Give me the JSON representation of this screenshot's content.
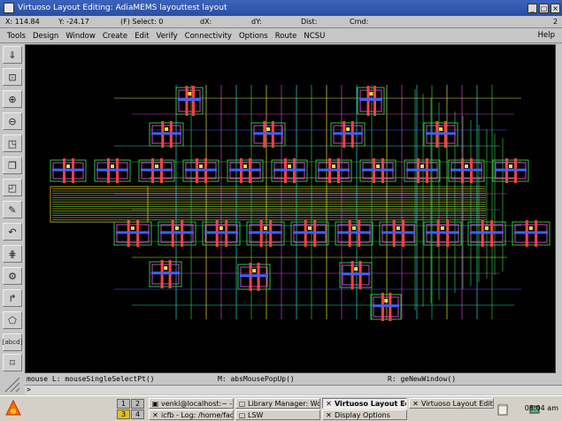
{
  "window": {
    "title": "Virtuoso   Layout Editing: AdiaMEMS layouttest layout",
    "buttons": [
      "_",
      "□",
      "×"
    ]
  },
  "status": {
    "x": "X:  114.84",
    "y": "Y:  -24.17",
    "select": "(F)  Select: 0",
    "dx": "dX:",
    "dy": "dY:",
    "dist": "Dist:",
    "cmd": "Cmd:",
    "num": "2"
  },
  "menu": {
    "items": [
      "Tools",
      "Design",
      "Window",
      "Create",
      "Edit",
      "Verify",
      "Connectivity",
      "Options",
      "Route",
      "NCSU"
    ],
    "help": "Help"
  },
  "tools": [
    "save-icon",
    "zoom-fit-icon",
    "zoom-in-icon",
    "zoom-out-icon",
    "stretch-icon",
    "copy-icon",
    "move-icon",
    "delete-icon",
    "undo-icon",
    "property-icon",
    "path-icon",
    "wire-icon",
    "polygon-icon",
    "label-icon",
    "ruler-icon",
    "instance-icon"
  ],
  "tool_labels": {
    "label": "[abcd]"
  },
  "mouse": {
    "left": "mouse L: mouseSingleSelectPt()",
    "middle": "M: absMousePopUp()",
    "right": "R: geNewWindow()"
  },
  "prompt": ">",
  "taskbar": {
    "pager": [
      "1",
      "2",
      "3",
      "4"
    ],
    "tasks": [
      {
        "label": "venki@localhost:~ - Sh",
        "icon": "terminal"
      },
      {
        "label": "Library Manager: Work",
        "icon": "window"
      },
      {
        "label": "Virtuoso   Layout Edit",
        "icon": "x",
        "active": true
      },
      {
        "label": "Virtuoso   Layout Editi",
        "icon": "x"
      },
      {
        "label": "icfb - Log: /home/face/",
        "icon": "x"
      },
      {
        "label": "LSW",
        "icon": "window"
      },
      {
        "label": "Display Options",
        "icon": "x"
      }
    ],
    "clock": "08:04 am"
  },
  "colors": {
    "title": "#2a4ea3",
    "canvas": "#000000",
    "panel": "#c6c6c6"
  }
}
